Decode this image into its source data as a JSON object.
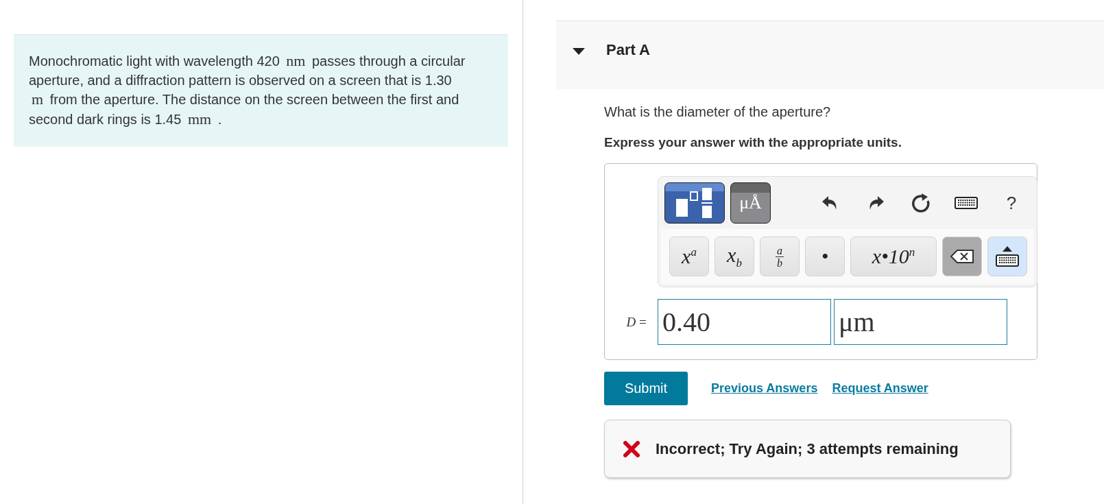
{
  "problem": {
    "segments": [
      {
        "kind": "text",
        "text": "Monochromatic light with wavelength 420 "
      },
      {
        "kind": "unit",
        "text": "nm"
      },
      {
        "kind": "text",
        "text": " passes through a circular aperture, and a diffraction pattern is observed on a screen that is 1.30 "
      },
      {
        "kind": "unit",
        "text": "m"
      },
      {
        "kind": "text",
        "text": " from the aperture. The distance on the screen between the first and second dark rings is 1.45 "
      },
      {
        "kind": "unit",
        "text": "mm"
      },
      {
        "kind": "text",
        "text": " ."
      }
    ]
  },
  "part": {
    "title": "Part A",
    "expanded": true,
    "question": "What is the diameter of the aperture?",
    "instruction": "Express your answer with the appropriate units.",
    "toolbar": {
      "palettes": [
        {
          "kind": "templates",
          "selected": true
        },
        {
          "kind": "units",
          "label": "μÅ",
          "selected": false
        }
      ],
      "actions": [
        {
          "kind": "undo"
        },
        {
          "kind": "redo"
        },
        {
          "kind": "reset"
        },
        {
          "kind": "keyboard"
        },
        {
          "kind": "help",
          "label": "?"
        }
      ],
      "keys": [
        {
          "kind": "math",
          "label": "x$^{a}$"
        },
        {
          "kind": "math",
          "label": "x$_{b}$"
        },
        {
          "kind": "fraction",
          "numerator": "a",
          "denominator": "b"
        },
        {
          "kind": "math",
          "label": "•"
        },
        {
          "kind": "wide",
          "label": "x•10$^{n}$"
        },
        {
          "kind": "backspace"
        },
        {
          "kind": "keyboard"
        }
      ]
    },
    "answer": {
      "label": "*D* =",
      "value": "0.40",
      "unit": "μm"
    },
    "submit": "Submit",
    "links": [
      "Previous Answers",
      "Request Answer"
    ],
    "feedback": {
      "correct": false,
      "message": "Incorrect; Try Again; 3 attempts remaining"
    }
  }
}
